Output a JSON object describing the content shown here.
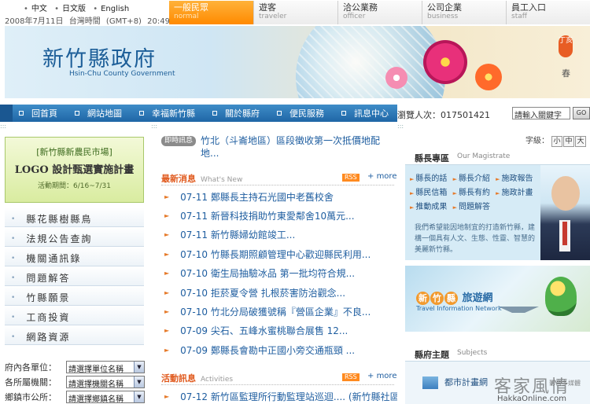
{
  "top": {
    "languages": [
      "中文",
      "日文版",
      "English"
    ],
    "date": "2008年7月11日",
    "zone": "台灣時間",
    "gmt": "(GMT+8)",
    "time": "20:49:24",
    "audience_tabs": [
      {
        "zh": "一般民眾",
        "en": "normal"
      },
      {
        "zh": "遊客",
        "en": "traveler"
      },
      {
        "zh": "洽公業務",
        "en": "officer"
      },
      {
        "zh": "公司企業",
        "en": "business"
      },
      {
        "zh": "員工入口",
        "en": "staff"
      }
    ]
  },
  "banner": {
    "logo": "新竹縣政府",
    "logo_en": "Hsin-Chu County Government",
    "badge": "丁亥",
    "season": "春"
  },
  "nav": {
    "items": [
      "回首頁",
      "網站地圖",
      "幸福新竹縣",
      "關於縣府",
      "便民服務",
      "訊息中心"
    ],
    "visits_label": "瀏覽人次：",
    "visits_value": "017501421",
    "search_value": "請輸入關鍵字",
    "go_label": "GO"
  },
  "left": {
    "market_title": "[新竹縣新農民市場]",
    "market_sub": "LOGO 設計甄選實施計畫",
    "market_date": "活動期間：6/16~7/31",
    "menu": [
      "縣花縣樹縣鳥",
      "法規公告查詢",
      "機關通訊錄",
      "問題解答",
      "竹縣願景",
      "工商投資",
      "網路資源"
    ],
    "selects": [
      {
        "label": "府內各單位：",
        "value": "請選擇單位名稱"
      },
      {
        "label": "各所屬機關：",
        "value": "請選擇機關名稱"
      },
      {
        "label": "鄉鎮市公所：",
        "value": "請選擇鄉鎮名稱"
      }
    ]
  },
  "center": {
    "ticker_badge": "即時訊息",
    "ticker_text": "竹北（斗崙地區）區段徵收第一次抵價地配地...",
    "news_title": "最新消息",
    "news_sub": "What's New",
    "rss": "RSS",
    "more": "more",
    "news": [
      "07-11 鄭縣長主持石光國中老舊校舍",
      "07-11 新晉科技捐助竹東愛鄰舍10萬元...",
      "07-11 新竹縣婦幼館竣工...",
      "07-10 竹縣長期照顧管理中心歡迎縣民利用...",
      "07-10 衛生局抽驗冰品 第一批均符合規...",
      "07-10 拒菸夏令營 扎根菸害防治觀念...",
      "07-10 竹北分局破獲號稱『營區企業』不良...",
      "07-09 尖石、五峰水蜜桃聯合展售 12...",
      "07-09 鄭縣長會勘中正國小旁交通瓶頸 ..."
    ],
    "activity_title": "活動訊息",
    "activity_sub": "Activities",
    "activities": [
      "07-12 新竹區監理所行動監理站巡迴.... (新竹縣社區服..."
    ]
  },
  "right": {
    "font_label": "字級：",
    "font_sizes": [
      "小",
      "中",
      "大"
    ],
    "mag_title": "縣長專區",
    "mag_sub": "Our Magistrate",
    "mag_links": [
      [
        "縣長的話",
        "縣長介紹",
        "施政報告"
      ],
      [
        "縣民信箱",
        "縣長有約",
        "施政計畫"
      ],
      [
        "推動成果",
        "問題解答"
      ]
    ],
    "mag_desc": "我們希望能因地制宜的打造新竹縣，建構一個具有人文、生態、性靈、智慧的美麗新竹縣。",
    "travel_hl": [
      "新",
      "竹",
      "縣"
    ],
    "travel_title": "旅遊網",
    "travel_sub": "Travel Information Network",
    "subj_title": "縣府主題",
    "subj_sub": "Subjects",
    "subj_item": "都市計畫網"
  },
  "watermark": {
    "big": "客家風情",
    "small": "影音多媒體",
    "url": "HakkaOnline.com"
  },
  "colors": {
    "accent_orange": "#ff8a00",
    "nav_blue": "#1f66a6",
    "link_blue": "#1f5ea0",
    "heading_orange": "#e05a1e"
  }
}
